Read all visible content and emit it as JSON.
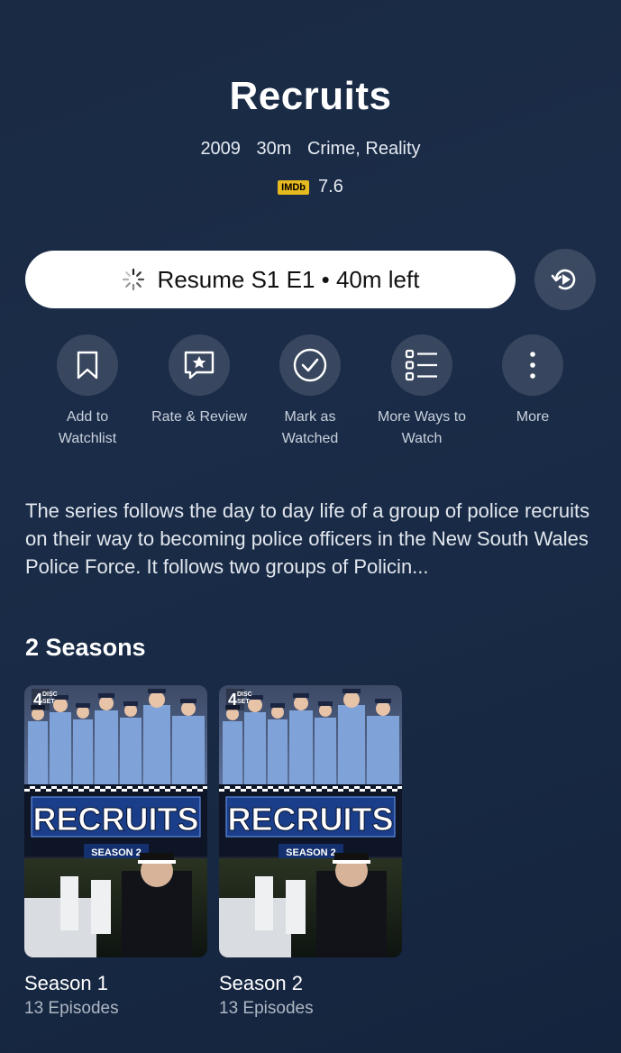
{
  "show": {
    "title": "Recruits",
    "year": "2009",
    "runtime": "30m",
    "genres": "Crime, Reality",
    "imdb_label": "IMDb",
    "imdb_rating": "7.6"
  },
  "resume": {
    "label": "Resume S1 E1 • 40m left"
  },
  "actions": [
    {
      "line1": "Add to",
      "line2": "Watchlist",
      "icon": "bookmark-icon"
    },
    {
      "line1": "Rate & Review",
      "line2": "",
      "icon": "star-speech-icon"
    },
    {
      "line1": "Mark as",
      "line2": "Watched",
      "icon": "check-circle-icon"
    },
    {
      "line1": "More Ways to",
      "line2": "Watch",
      "icon": "list-icon"
    },
    {
      "line1": "More",
      "line2": "",
      "icon": "more-vertical-icon"
    }
  ],
  "description": "The series follows the day to day life of a group of police recruits on their way to becoming police officers in the New South Wales Police Force. It follows two groups of Policin...",
  "seasons": {
    "heading": "2 Seasons",
    "items": [
      {
        "name": "Season 1",
        "episodes": "13 Episodes",
        "poster_title": "RECRUITS",
        "poster_subtitle": "SEASON 2",
        "poster_badge_top": "4",
        "poster_badge_word1": "DISC",
        "poster_badge_word2": "SET"
      },
      {
        "name": "Season 2",
        "episodes": "13 Episodes",
        "poster_title": "RECRUITS",
        "poster_subtitle": "SEASON 2",
        "poster_badge_top": "4",
        "poster_badge_word1": "DISC",
        "poster_badge_word2": "SET"
      }
    ]
  },
  "colors": {
    "background": "#1a2a44",
    "imdb": "#e6b91e",
    "resume_button": "#ffffff"
  }
}
